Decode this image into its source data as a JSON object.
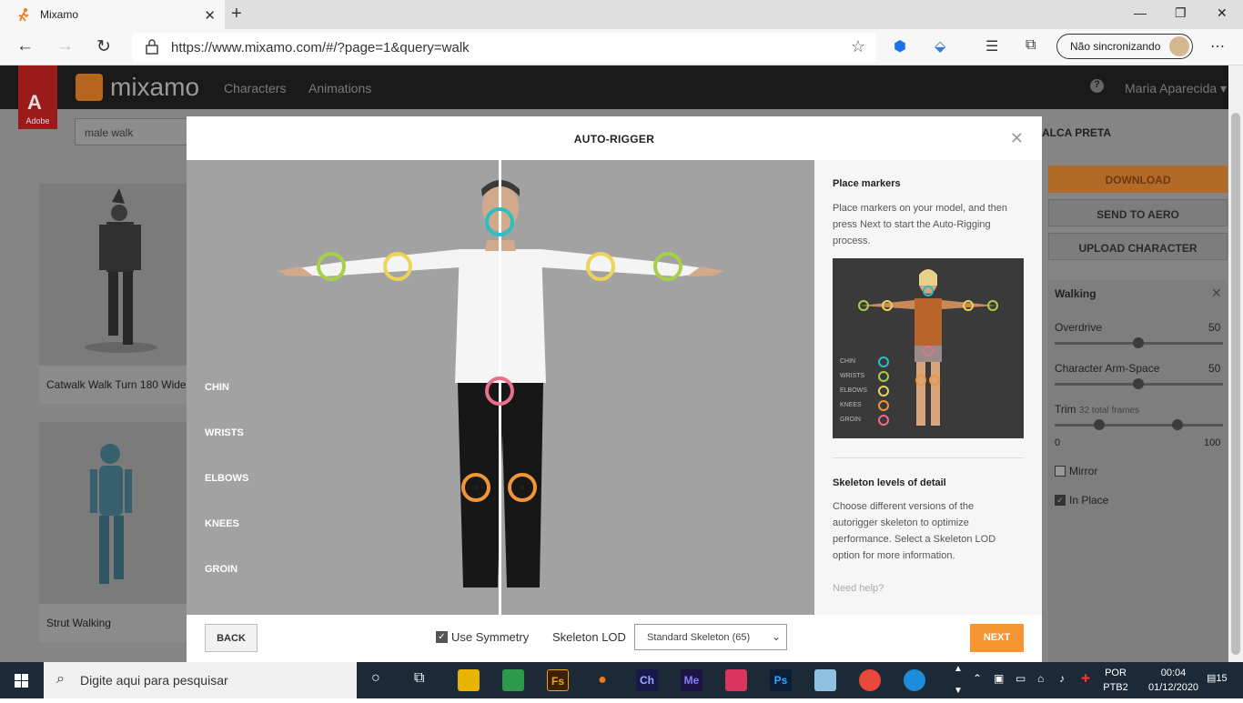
{
  "browser": {
    "tab_title": "Mixamo",
    "url": "https://www.mixamo.com/#/?page=1&query=walk",
    "sync_label": "Não sincronizando"
  },
  "mixamo": {
    "adobe_label": "Adobe",
    "brand": "mixamo",
    "nav": [
      "Characters",
      "Animations"
    ],
    "user": "Maria Aparecida",
    "search_value": "male walk",
    "cards": [
      {
        "title": "Catwalk Walk Turn 180 Wide"
      },
      {
        "title": "Strut Walking"
      }
    ],
    "right_panel": {
      "character_name": "ALCA PRETA",
      "download": "DOWNLOAD",
      "send_aero": "SEND TO AERO",
      "upload": "UPLOAD CHARACTER",
      "anim_name": "Walking",
      "overdrive_label": "Overdrive",
      "overdrive_value": "50",
      "armspace_label": "Character Arm-Space",
      "armspace_value": "50",
      "trim_label": "Trim",
      "trim_frames": "32 total frames",
      "trim_min": "0",
      "trim_max": "100",
      "mirror_label": "Mirror",
      "inplace_label": "In Place"
    }
  },
  "modal": {
    "title": "AUTO-RIGGER",
    "markers": [
      "CHIN",
      "WRISTS",
      "ELBOWS",
      "KNEES",
      "GROIN"
    ],
    "marker_colors": {
      "chin": "#2bbfc4",
      "wrists": "#a8cf4a",
      "elbows": "#ecd35a",
      "knees": "#f0953a",
      "groin": "#e8708a"
    },
    "side": {
      "place_heading": "Place markers",
      "place_text": "Place markers on your model, and then press Next to start the Auto-Rigging process.",
      "preview_labels": [
        "CHIN",
        "WRISTS",
        "ELBOWS",
        "KNEES",
        "GROIN"
      ],
      "lod_heading": "Skeleton levels of detail",
      "lod_text": "Choose different versions of the autorigger skeleton to optimize performance. Select a Skeleton LOD option for more information.",
      "help": "Need help?"
    },
    "footer": {
      "back": "BACK",
      "symmetry": "Use Symmetry",
      "lod_label": "Skeleton LOD",
      "lod_value": "Standard Skeleton (65)",
      "next": "NEXT"
    }
  },
  "taskbar": {
    "search_placeholder": "Digite aqui para pesquisar",
    "lang1": "POR",
    "lang2": "PTB2",
    "time": "00:04",
    "date": "01/12/2020",
    "notif_count": "15"
  }
}
